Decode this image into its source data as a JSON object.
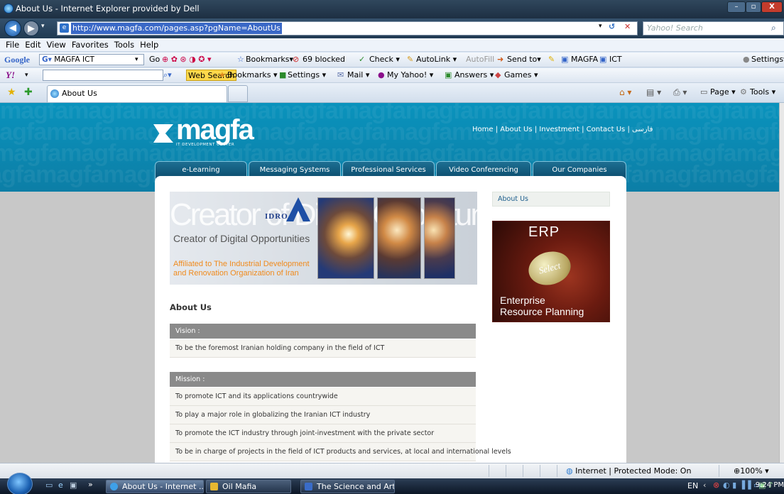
{
  "window": {
    "title": "About Us - Internet Explorer provided by Dell",
    "btn_min": "–",
    "btn_max": "▫",
    "btn_close": "X"
  },
  "address_bar": {
    "url": "http://www.magfa.com/pages.asp?pgName=AboutUs",
    "search_placeholder": "Yahoo! Search"
  },
  "menu": [
    "File",
    "Edit",
    "View",
    "Favorites",
    "Tools",
    "Help"
  ],
  "google_toolbar": {
    "brand": "Google",
    "query": "MAGFA ICT",
    "go": "Go",
    "bookmarks": "Bookmarks▾",
    "blocked": "69 blocked",
    "check": "Check ▾",
    "autolink": "AutoLink ▾",
    "autofill": "AutoFill",
    "sendto": "Send to▾",
    "magfa": "MAGFA",
    "ict": "ICT",
    "settings": "Settings▾"
  },
  "yahoo_toolbar": {
    "logo": "Y!",
    "web_search": "Web Search",
    "bookmarks": "Bookmarks ▾",
    "settings": "Settings ▾",
    "mail": "Mail ▾",
    "myyahoo": "My Yahoo! ▾",
    "answers": "Answers ▾",
    "games": "Games ▾"
  },
  "tabs": {
    "active_tab": "About Us",
    "page_menu": "Page ▾",
    "tools_menu": "Tools ▾"
  },
  "site": {
    "logo_word": "magfa",
    "logo_sub": "IT DEVELOPMENT CENTER",
    "top_links": [
      "Home",
      "About Us",
      "Investment",
      "Contact Us",
      "فارسی"
    ],
    "nav_tabs": [
      "e-Learning",
      "Messaging Systems",
      "Professional Services",
      "Video Conferencing",
      "Our Companies"
    ],
    "banner": {
      "big_text": "Creator of Digital Opportunities",
      "creator": "Creator of  Digital Opportunities",
      "idro": "IDRO",
      "affiliated": "Affiliated to The Industrial Development and Renovation Organization of Iran"
    },
    "heading": "About Us",
    "vision_label": "Vision :",
    "vision_items": [
      "To be the foremost Iranian holding company in the field of ICT"
    ],
    "mission_label": "Mission :",
    "mission_items": [
      "To promote ICT and its applications countrywide",
      "To play a major role in globalizing the Iranian ICT industry",
      "To promote the ICT industry through joint-investment with the private sector",
      "To be in charge of projects in the field of ICT products and services, at local and international levels"
    ],
    "side_about": "About Us",
    "erp": {
      "title": "ERP",
      "select": "Select",
      "line1": "Enterprise",
      "line2": "Resource Planning"
    }
  },
  "status": {
    "zone": "Internet | Protected Mode: On",
    "zoom": "100%"
  },
  "taskbar": {
    "items": [
      "About Us - Internet ...",
      "Oil Mafia",
      "The Science and Art..."
    ],
    "lang": "EN",
    "time": "9:24 PM"
  },
  "colors": {
    "hero": "#0a93bd",
    "section_bar": "#8a8a8a",
    "banner_orange": "#f08a1c",
    "link_blue": "#1c5d8c"
  }
}
